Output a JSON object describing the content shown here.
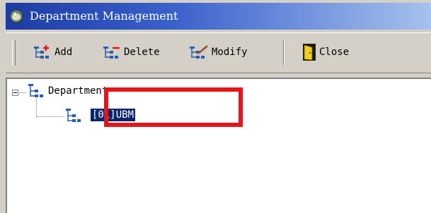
{
  "window": {
    "title": "Department Management",
    "icon": "app-icon"
  },
  "toolbar": {
    "add_label": "Add",
    "delete_label": "Delete",
    "modify_label": "Modify",
    "close_label": "Close"
  },
  "tree": {
    "root": {
      "label": "Department",
      "expanded": true,
      "icon": "department-tree-icon"
    },
    "children": [
      {
        "label": "[01]UBM",
        "selected": true,
        "icon": "department-tree-icon"
      }
    ]
  },
  "annotation": {
    "highlight_color": "#e8141c"
  },
  "colors": {
    "titlebar_start": "#1c3aa4",
    "titlebar_end": "#a6c2ee",
    "selection": "#0a246a"
  }
}
